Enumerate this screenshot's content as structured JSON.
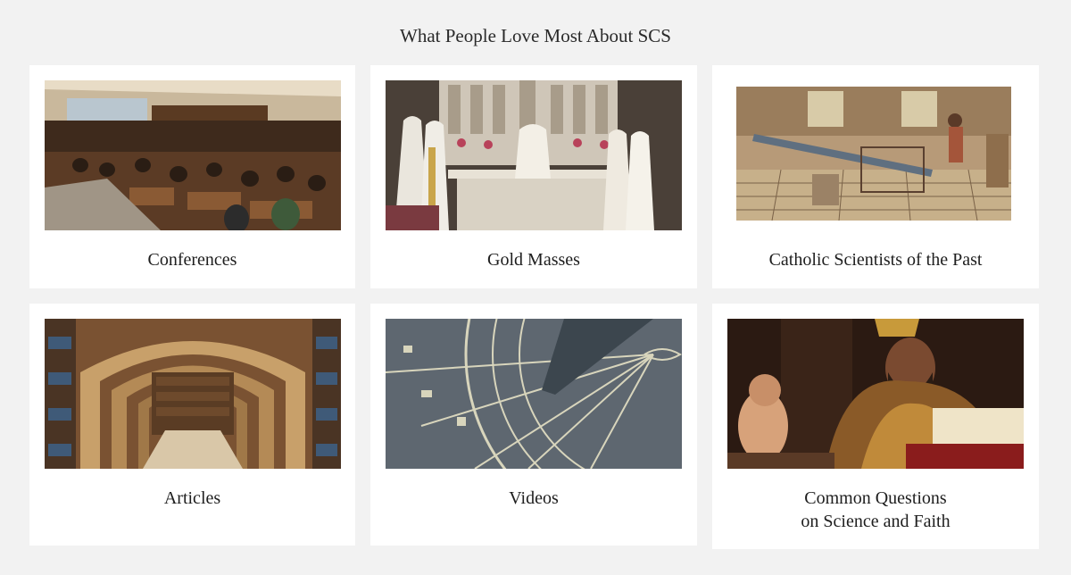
{
  "section": {
    "title": "What People Love Most About SCS"
  },
  "cards": [
    {
      "label": "Conferences",
      "image_alt": "conference-audience"
    },
    {
      "label": "Gold Masses",
      "image_alt": "mass-altar"
    },
    {
      "label": "Catholic Scientists of the Past",
      "image_alt": "historic-engraving"
    },
    {
      "label": "Articles",
      "image_alt": "library-arches"
    },
    {
      "label": "Videos",
      "image_alt": "sundial-closeup"
    },
    {
      "label_line1": "Common Questions",
      "label_line2": "on Science and Faith",
      "image_alt": "saint-painting"
    }
  ]
}
